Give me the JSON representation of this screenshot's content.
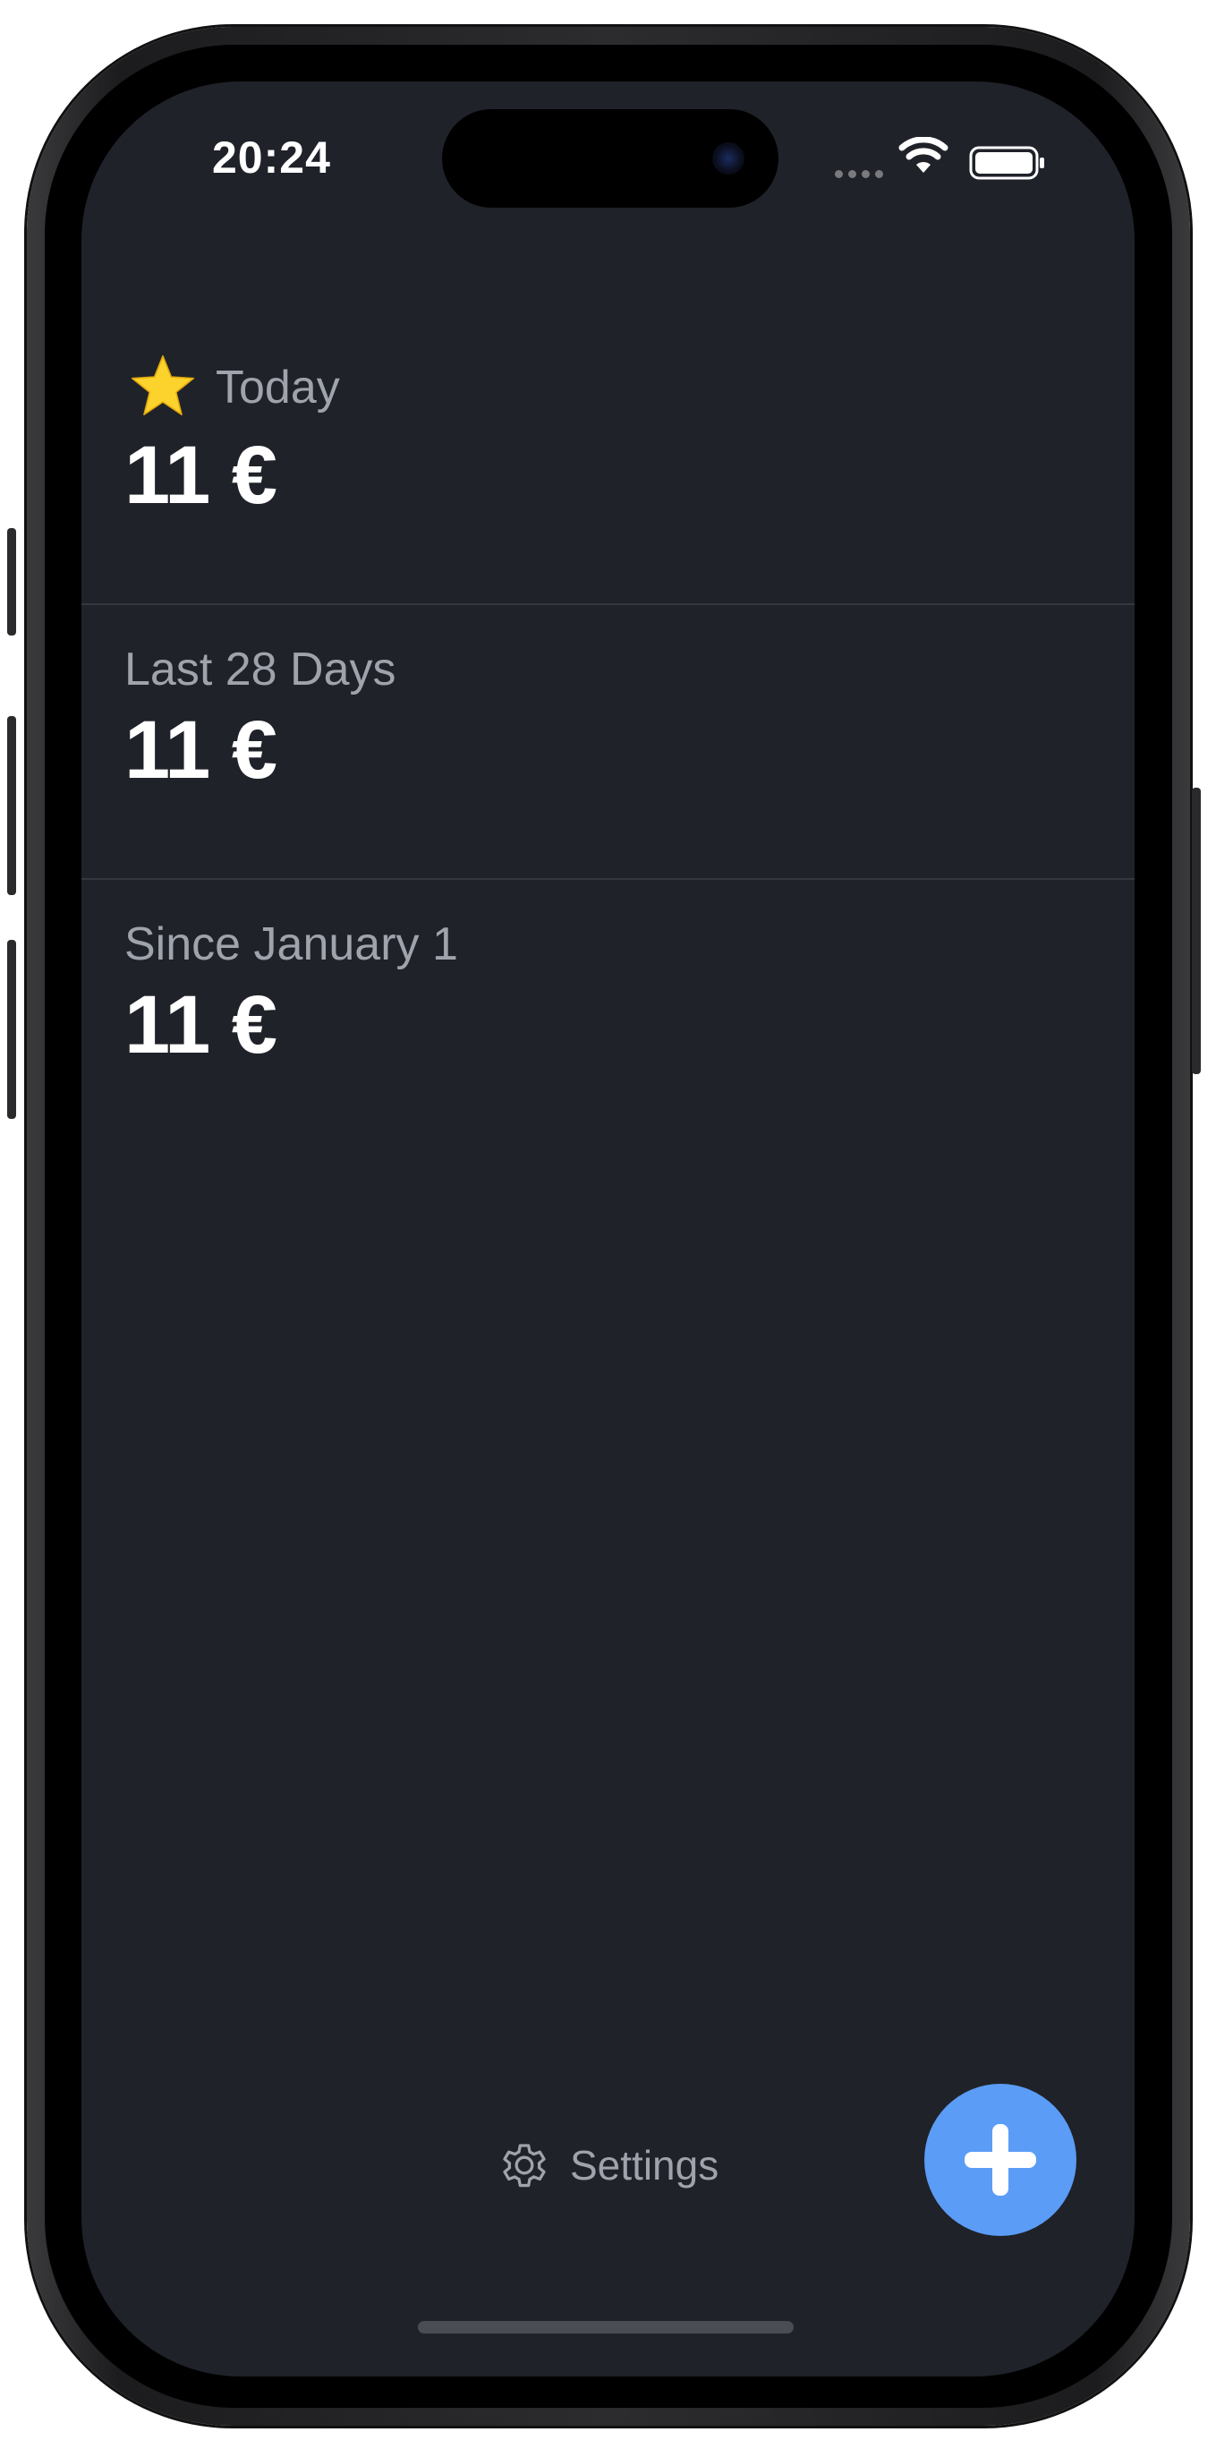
{
  "status_bar": {
    "time": "20:24"
  },
  "summary": {
    "today": {
      "label": "Today",
      "value": "11 €"
    },
    "last_28_days": {
      "label": "Last 28 Days",
      "value": "11 €"
    },
    "since_jan_1": {
      "label": "Since January 1",
      "value": "11 €"
    }
  },
  "bottom_bar": {
    "settings_label": "Settings"
  },
  "icons": {
    "favorite": "star-icon",
    "settings": "gear-icon",
    "add": "plus-icon"
  },
  "colors": {
    "background": "#1f2229",
    "accent": "#5b9cf6",
    "star": "#fcd22d",
    "label": "#9fa3ab",
    "value": "#ffffff"
  }
}
